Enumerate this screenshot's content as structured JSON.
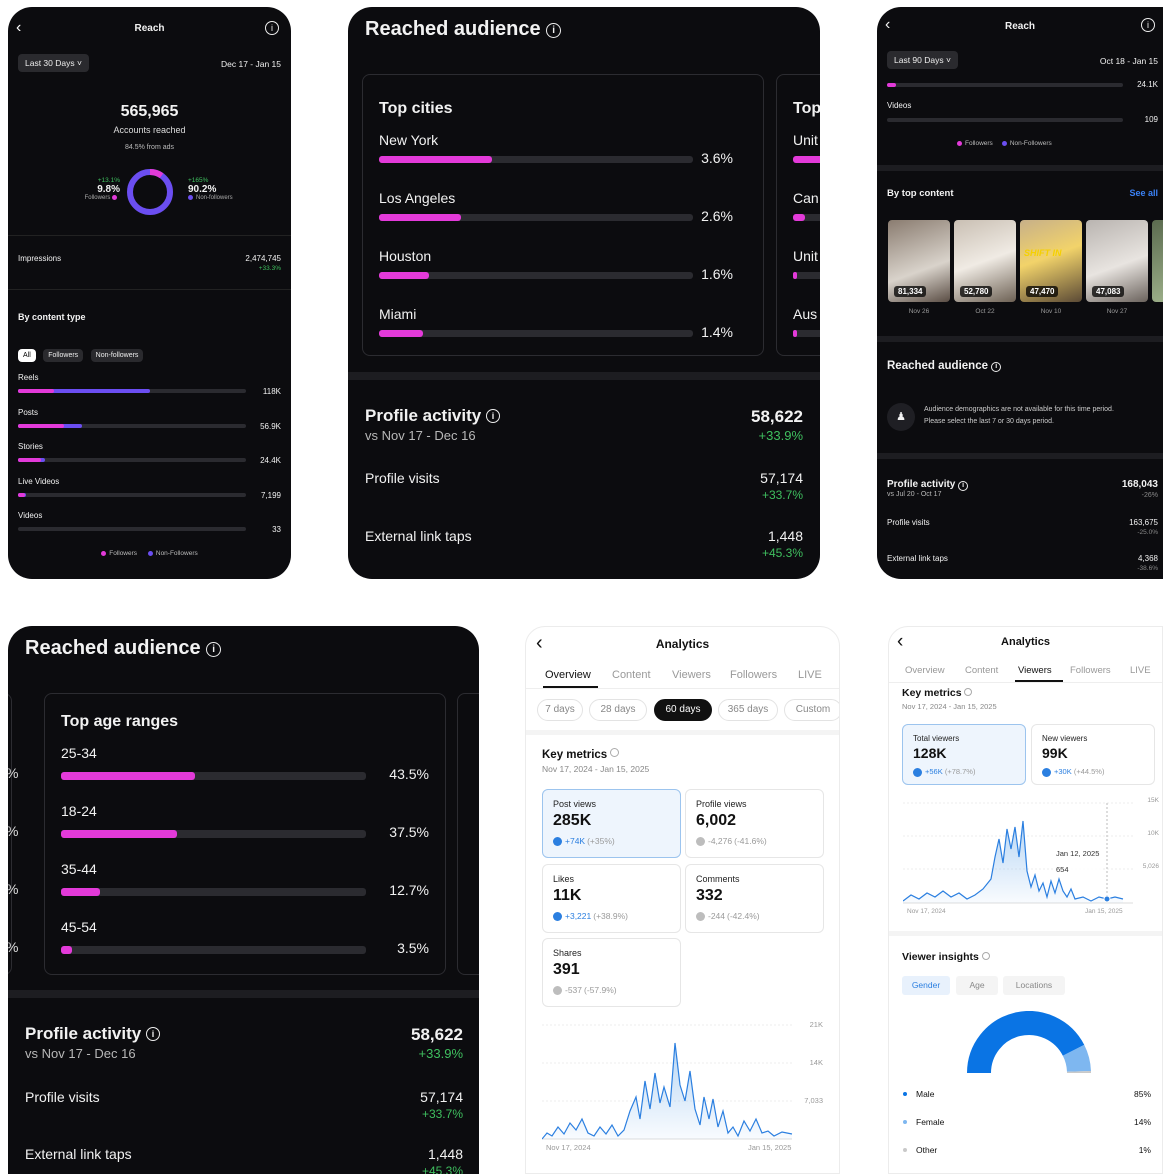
{
  "panel1": {
    "title": "Reach",
    "range": "Last 30 Days",
    "dates": "Dec 17 - Jan 15",
    "accounts": "565,965",
    "accounts_label": "Accounts reached",
    "ads": "84.5% from ads",
    "f_delta": "+13.1%",
    "f_pct": "9.8%",
    "f_label": "Followers",
    "nf_delta": "+165%",
    "nf_pct": "90.2%",
    "nf_label": "Non-followers",
    "donut_followers_fraction": 0.098,
    "impr_label": "Impressions",
    "impr_val": "2,474,745",
    "impr_delta": "+33.3%",
    "content_type": "By content type",
    "filters": [
      "All",
      "Followers",
      "Non-followers"
    ],
    "rows": [
      {
        "label": "Reels",
        "value": "118K",
        "followers": 0.16,
        "total": 0.58
      },
      {
        "label": "Posts",
        "value": "56.9K",
        "followers": 0.2,
        "total": 0.28
      },
      {
        "label": "Stories",
        "value": "24.4K",
        "followers": 0.1,
        "total": 0.12
      },
      {
        "label": "Live Videos",
        "value": "7,199",
        "followers": 0.03,
        "total": 0.035
      },
      {
        "label": "Videos",
        "value": "33",
        "followers": 0.0,
        "total": 0.0
      }
    ],
    "legend_f": "Followers",
    "legend_nf": "Non-Followers"
  },
  "panel2": {
    "title": "Reached audience",
    "top_cities": "Top cities",
    "cities": [
      {
        "name": "New York",
        "pct": "3.6%",
        "frac": 0.036
      },
      {
        "name": "Los Angeles",
        "pct": "2.6%",
        "frac": 0.026
      },
      {
        "name": "Houston",
        "pct": "1.6%",
        "frac": 0.016
      },
      {
        "name": "Miami",
        "pct": "1.4%",
        "frac": 0.014
      }
    ],
    "next_title": "Top",
    "next_items": [
      "Unit",
      "Can",
      "Unit",
      "Aus"
    ],
    "activity": "Profile activity",
    "activity_val": "58,622",
    "vs": "vs Nov 17 - Dec 16",
    "activity_delta": "+33.9%",
    "visits": "Profile visits",
    "visits_val": "57,174",
    "visits_delta": "+33.7%",
    "links": "External link taps",
    "links_val": "1,448",
    "links_delta": "+45.3%"
  },
  "panel3": {
    "title": "Reach",
    "range": "Last 90 Days",
    "dates": "Oct 18 - Jan 15",
    "first_val": "24.1K",
    "videos": "Videos",
    "videos_val": "109",
    "legend_f": "Followers",
    "legend_nf": "Non-Followers",
    "top_content": "By top content",
    "see_all": "See all",
    "thumbs": [
      {
        "val": "81,334",
        "date": "Nov 26",
        "overlay": ""
      },
      {
        "val": "52,780",
        "date": "Oct 22",
        "overlay": ""
      },
      {
        "val": "47,470",
        "date": "Nov 10",
        "overlay": "SHIFT IN"
      },
      {
        "val": "47,083",
        "date": "Nov 27",
        "overlay": ""
      }
    ],
    "audience": "Reached audience",
    "notice_1": "Audience demographics are not available for this time period.",
    "notice_2": "Please select the last 7 or 30 days period.",
    "activity": "Profile activity",
    "activity_val": "168,043",
    "vs": "vs Jul 20 - Oct 17",
    "activity_delta": "-26%",
    "visits": "Profile visits",
    "visits_val": "163,675",
    "visits_delta": "-25.0%",
    "links": "External link taps",
    "links_val": "4,368",
    "links_delta": "-38.6%"
  },
  "panel4": {
    "title": "Reached audience",
    "age_title": "Top age ranges",
    "ages": [
      {
        "name": "25-34",
        "pct": "43.5%",
        "frac": 0.435
      },
      {
        "name": "18-24",
        "pct": "37.5%",
        "frac": 0.375
      },
      {
        "name": "35-44",
        "pct": "12.7%",
        "frac": 0.127
      },
      {
        "name": "45-54",
        "pct": "3.5%",
        "frac": 0.035
      }
    ],
    "activity": "Profile activity",
    "activity_val": "58,622",
    "vs": "vs Nov 17 - Dec 16",
    "activity_delta": "+33.9%",
    "visits": "Profile visits",
    "visits_val": "57,174",
    "visits_delta": "+33.7%",
    "links": "External link taps",
    "links_val": "1,448",
    "links_delta": "+45.3%"
  },
  "panel5": {
    "title": "Analytics",
    "tabs": [
      "Overview",
      "Content",
      "Viewers",
      "Followers",
      "LIVE"
    ],
    "ranges": [
      "7 days",
      "28 days",
      "60 days",
      "365 days",
      "Custom"
    ],
    "key": "Key metrics",
    "period": "Nov 17, 2024 - Jan 15, 2025",
    "metrics": [
      {
        "label": "Post views",
        "value": "285K",
        "delta_a": "+74K",
        "delta_b": "(+35%)"
      },
      {
        "label": "Profile views",
        "value": "6,002",
        "delta_a": "-4,276",
        "delta_b": "(-41.6%)"
      },
      {
        "label": "Likes",
        "value": "11K",
        "delta_a": "+3,221",
        "delta_b": "(+38.9%)"
      },
      {
        "label": "Comments",
        "value": "332",
        "delta_a": "-244",
        "delta_b": "(-42.4%)"
      },
      {
        "label": "Shares",
        "value": "391",
        "delta_a": "-537",
        "delta_b": "(-57.9%)"
      }
    ],
    "y_ticks": [
      "21K",
      "14K",
      "7,033"
    ],
    "x_start": "Nov 17, 2024",
    "x_end": "Jan 15, 2025"
  },
  "panel6": {
    "title": "Analytics",
    "tabs": [
      "Overview",
      "Content",
      "Viewers",
      "Followers",
      "LIVE"
    ],
    "key": "Key metrics",
    "period": "Nov 17, 2024 - Jan 15, 2025",
    "total_label": "Total viewers",
    "total_val": "128K",
    "total_delta_a": "+56K",
    "total_delta_b": "(+78.7%)",
    "new_label": "New viewers",
    "new_val": "99K",
    "new_delta_a": "+30K",
    "new_delta_b": "(+44.5%)",
    "y_ticks": [
      "15K",
      "10K",
      "5,026"
    ],
    "x_start": "Nov 17, 2024",
    "x_end": "Jan 15, 2025",
    "tooltip_date": "Jan 12, 2025",
    "tooltip_val": "654",
    "insights": "Viewer insights",
    "insight_tabs": [
      "Gender",
      "Age",
      "Locations"
    ],
    "gender": [
      {
        "label": "Male",
        "pct": "85%",
        "frac": 0.85,
        "color": "#0a74e4"
      },
      {
        "label": "Female",
        "pct": "14%",
        "frac": 0.14,
        "color": "#7eb7f0"
      },
      {
        "label": "Other",
        "pct": "1%",
        "frac": 0.01,
        "color": "#c9c9c9"
      }
    ]
  }
}
